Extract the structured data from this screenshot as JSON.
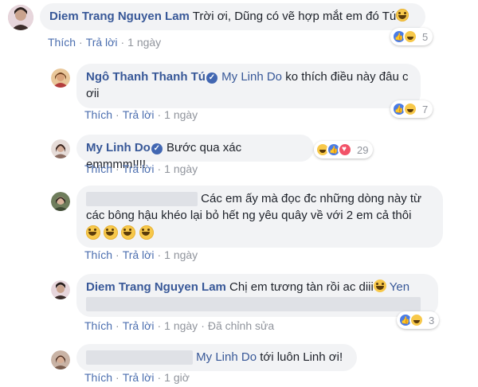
{
  "common": {
    "like": "Thích",
    "reply": "Trả lời",
    "edited": "Đã chỉnh sửa"
  },
  "comments": [
    {
      "author": "Diem Trang Nguyen Lam",
      "text": "Trời ơi, Dũng có vẽ hợp mắt em đó Tú",
      "time": "1 ngày",
      "reactions": [
        "like",
        "haha"
      ],
      "reaction_count": "5",
      "avatar_color": "#d5b8c1"
    },
    {
      "author": "Ngô Thanh Thanh Tú",
      "mention": "My Linh Do",
      "text_line1": "ko thích điều này đâu c",
      "text_line2": "ơii",
      "time": "1 ngày",
      "reactions": [
        "like",
        "haha"
      ],
      "reaction_count": "7",
      "avatar_color": "#d79e69"
    },
    {
      "author": "My Linh Do",
      "text": "Bước qua xác emmmm!!!!",
      "time": "1 ngày",
      "reactions": [
        "haha",
        "like",
        "love"
      ],
      "reaction_count": "29",
      "avatar_color": "#c9a79b"
    },
    {
      "text_line1": "Các em ấy mà đọc đc những dòng này từ",
      "text_line2": "các bông hậu khéo lại bỏ hết ng yêu quây về với 2 em cả thôi",
      "time": "1 ngày",
      "avatar_color": "#7a8a6a"
    },
    {
      "author": "Diem Trang Nguyen Lam",
      "text": "Chị em tương tàn rồi ac diii",
      "mention": "Yen",
      "time": "1 ngày",
      "reactions": [
        "like",
        "haha"
      ],
      "reaction_count": "3",
      "avatar_color": "#d5b8c1"
    },
    {
      "mention": "My Linh Do",
      "text": "tới luôn Linh ơi!",
      "time": "1 giờ",
      "avatar_color": "#b79a88"
    }
  ],
  "colors": {
    "name": "#385898",
    "bubble": "#f2f3f5",
    "meta": "#90949c",
    "link": "#4b6eaf"
  }
}
